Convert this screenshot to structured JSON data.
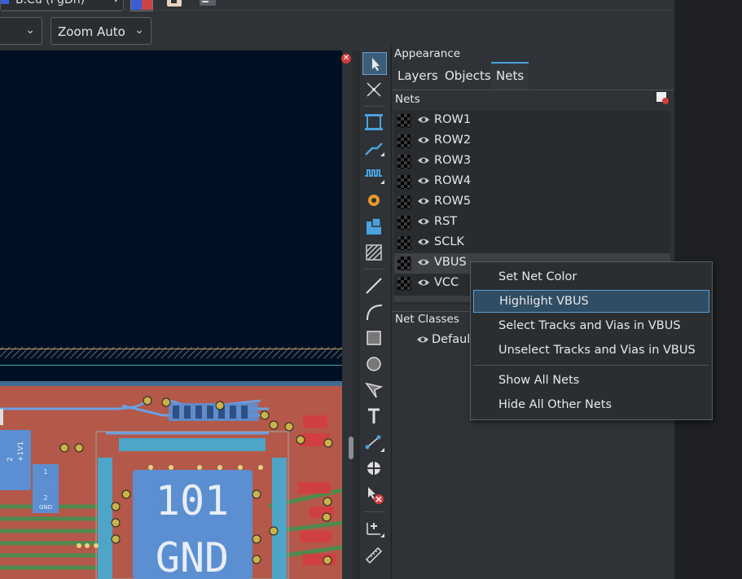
{
  "toolbar": {
    "layer_select": "B.Cu (PgDn)",
    "grid_dropdown": "",
    "zoom_dropdown": "Zoom Auto"
  },
  "board": {
    "big_pad_number": "101",
    "big_pad_net": "GND",
    "small_label_a": "+1V1",
    "small_label_b": "2",
    "small_label_c": "1",
    "small_label_d": "2",
    "small_label_e": "GND"
  },
  "appearance": {
    "title": "Appearance",
    "tabs": [
      "Layers",
      "Objects",
      "Nets"
    ],
    "active_tab": "Nets",
    "nets_header": "Nets",
    "nets": [
      "ROW1",
      "ROW2",
      "ROW3",
      "ROW4",
      "ROW5",
      "RST",
      "SCLK",
      "VBUS",
      "VCC"
    ],
    "highlighted_net": "VBUS",
    "net_classes_header": "Net Classes",
    "net_classes": [
      "Default"
    ]
  },
  "context_menu": {
    "items": [
      "Set Net Color",
      "Highlight VBUS",
      "Select Tracks and Vias in VBUS",
      "Unselect Tracks and Vias in VBUS",
      "Show All Nets",
      "Hide All Other Nets"
    ],
    "active_item": "Highlight VBUS"
  },
  "tools": [
    "select-tool",
    "local-ratsnest-tool",
    "footprint-tool",
    "route-track-tool",
    "tune-length-tool",
    "add-via-tool",
    "zone-tool",
    "rule-area-tool",
    "line-tool",
    "arc-tool",
    "rectangle-tool",
    "circle-tool",
    "polygon-tool",
    "text-tool",
    "dimension-tool",
    "origin-tool",
    "delete-tool",
    "grid-origin-tool",
    "measure-tool"
  ],
  "colors": {
    "canvas_bg": "#001023",
    "copper_back": "#b4584a",
    "pad_blue": "#5b8fd1",
    "accent": "#4aa3df",
    "menu_active": "#2f4d63"
  }
}
